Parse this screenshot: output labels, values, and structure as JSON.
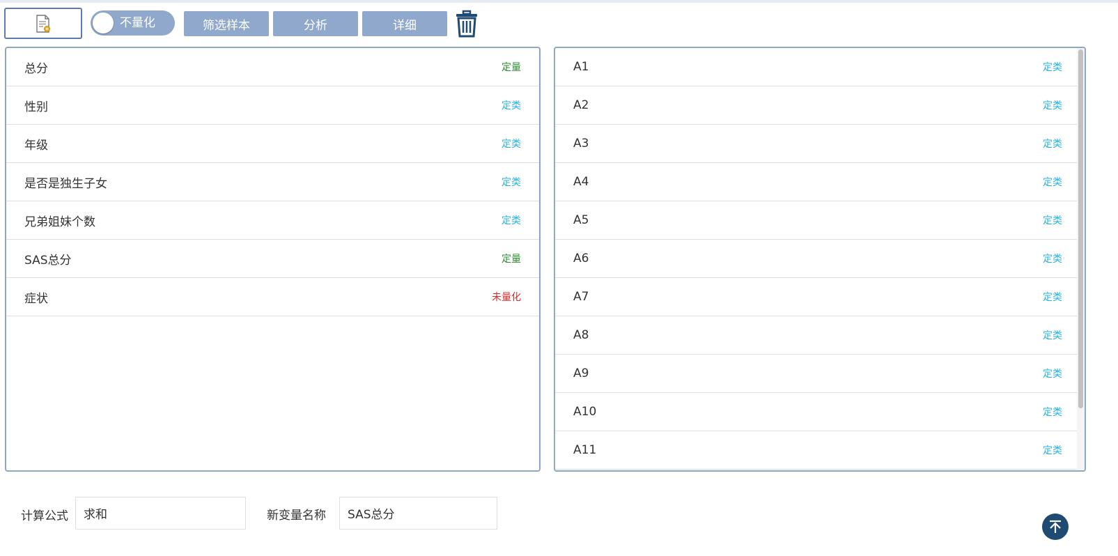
{
  "toolbar": {
    "file_icon": "document-gear-icon",
    "toggle_label": "不量化",
    "filter_label": "筛选样本",
    "analyze_label": "分析",
    "detail_label": "详细",
    "trash_icon": "trash-icon"
  },
  "left_list": [
    {
      "name": "总分",
      "tag": "定量",
      "tag_color": "#2e8b2e"
    },
    {
      "name": "性别",
      "tag": "定类",
      "tag_color": "#27b3e0"
    },
    {
      "name": "年级",
      "tag": "定类",
      "tag_color": "#27b3e0"
    },
    {
      "name": "是否是独生子女",
      "tag": "定类",
      "tag_color": "#27b3e0"
    },
    {
      "name": "兄弟姐妹个数",
      "tag": "定类",
      "tag_color": "#27b3e0"
    },
    {
      "name": "SAS总分",
      "tag": "定量",
      "tag_color": "#2e8b2e"
    },
    {
      "name": "症状",
      "tag": "未量化",
      "tag_color": "#d42a2a"
    }
  ],
  "right_list": [
    {
      "name": "A1",
      "tag": "定类"
    },
    {
      "name": "A2",
      "tag": "定类"
    },
    {
      "name": "A3",
      "tag": "定类"
    },
    {
      "name": "A4",
      "tag": "定类"
    },
    {
      "name": "A5",
      "tag": "定类"
    },
    {
      "name": "A6",
      "tag": "定类"
    },
    {
      "name": "A7",
      "tag": "定类"
    },
    {
      "name": "A8",
      "tag": "定类"
    },
    {
      "name": "A9",
      "tag": "定类"
    },
    {
      "name": "A10",
      "tag": "定类"
    },
    {
      "name": "A11",
      "tag": "定类"
    }
  ],
  "form": {
    "formula_label": "计算公式",
    "formula_value": "求和",
    "newvar_label": "新变量名称",
    "newvar_value": "SAS总分"
  },
  "colors": {
    "accent": "#8fa8cc",
    "border": "#8fa6c8",
    "quant": "#2e8b2e",
    "category": "#27b3e0",
    "unquant": "#d42a2a",
    "trash": "#1f4a72"
  }
}
